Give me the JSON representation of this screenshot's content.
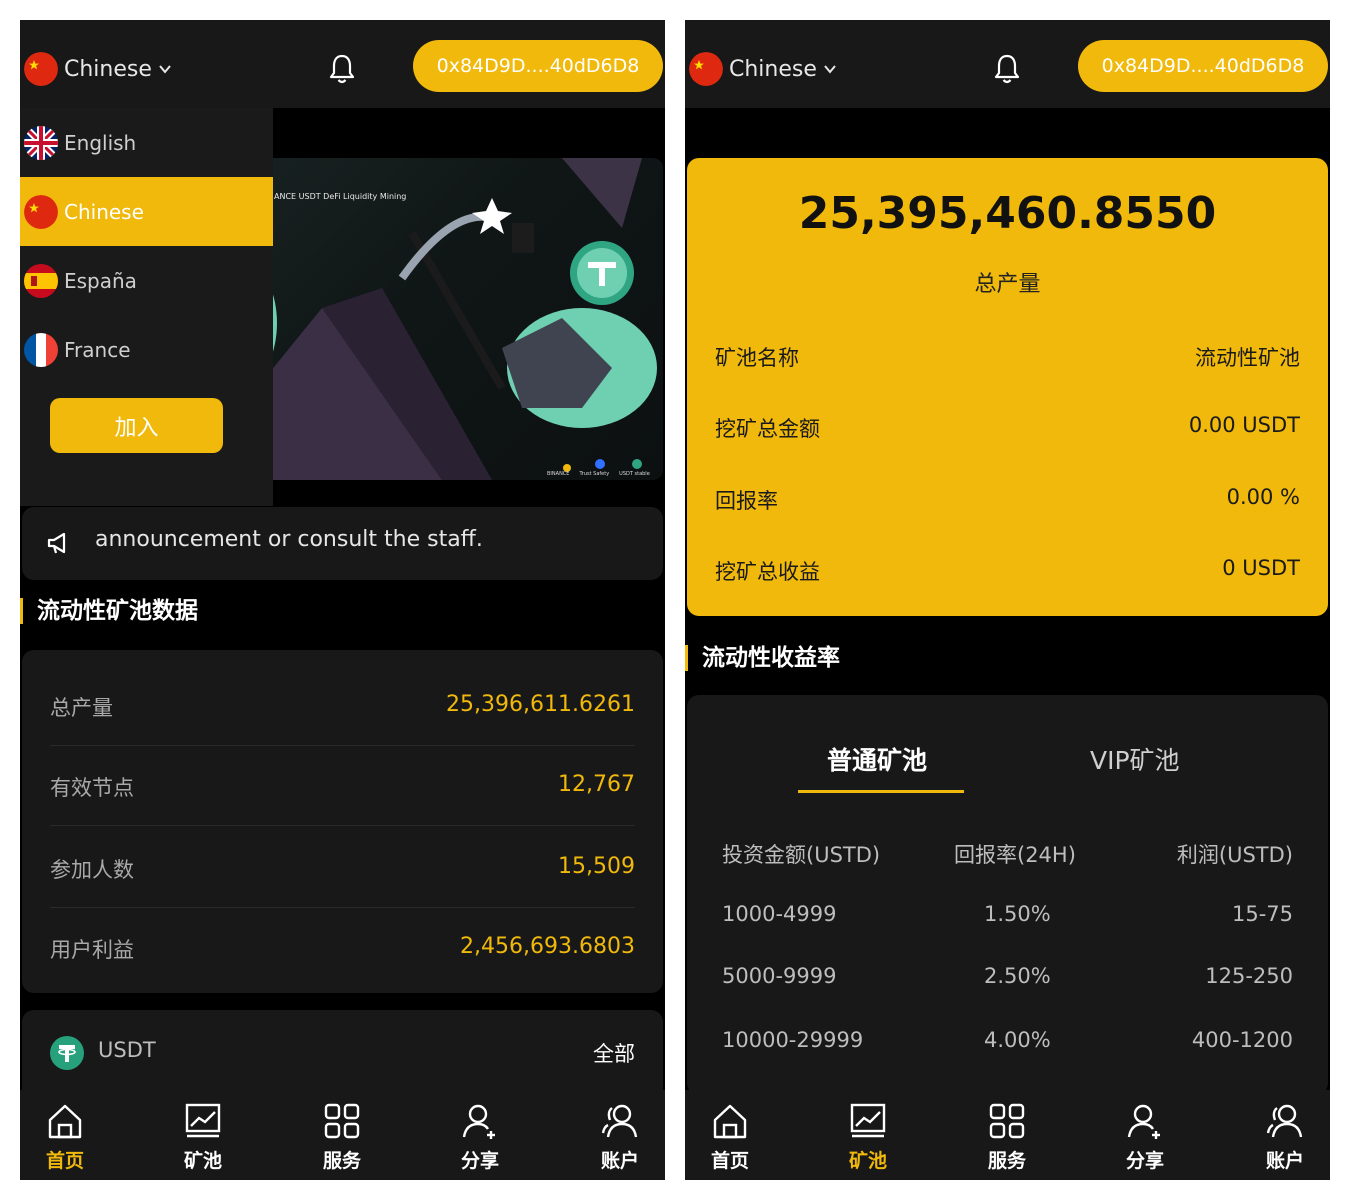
{
  "header": {
    "language": "Chinese",
    "wallet": "0x84D9D....40dD6D8"
  },
  "language_menu": {
    "items": [
      {
        "label": "English"
      },
      {
        "label": "Chinese"
      },
      {
        "label": "España"
      },
      {
        "label": "France"
      }
    ],
    "join_label": "加入"
  },
  "banner": {
    "title": "USDT DeFi Liquidity Mining",
    "brand_left": "ANCE",
    "logos": [
      "BINANCE",
      "Trust Safety",
      "USDT stable"
    ]
  },
  "announcement": {
    "text": "announcement or consult the staff."
  },
  "pool_data": {
    "title": "流动性矿池数据",
    "rows": [
      {
        "label": "总产量",
        "value": "25,396,611.6261"
      },
      {
        "label": "有效节点",
        "value": "12,767"
      },
      {
        "label": "参加人数",
        "value": "15,509"
      },
      {
        "label": "用户利益",
        "value": "2,456,693.6803"
      }
    ]
  },
  "usdt_card": {
    "label": "USDT",
    "all_label": "全部"
  },
  "mining": {
    "total_value": "25,395,460.8550",
    "total_label": "总产量",
    "rows": [
      {
        "label": "矿池名称",
        "value": "流动性矿池"
      },
      {
        "label": "挖矿总金额",
        "value": "0.00 USDT"
      },
      {
        "label": "回报率",
        "value": "0.00 %"
      },
      {
        "label": "挖矿总收益",
        "value": "0 USDT"
      }
    ]
  },
  "yield": {
    "title": "流动性收益率",
    "tabs": [
      "普通矿池",
      "VIP矿池"
    ],
    "headers": [
      "投资金额(USTD)",
      "回报率(24H)",
      "利润(USTD)"
    ],
    "rows": [
      [
        "1000-4999",
        "1.50%",
        "15-75"
      ],
      [
        "5000-9999",
        "2.50%",
        "125-250"
      ],
      [
        "10000-29999",
        "4.00%",
        "400-1200"
      ]
    ]
  },
  "nav": {
    "items": [
      {
        "label": "首页",
        "icon": "home-icon"
      },
      {
        "label": "矿池",
        "icon": "chart-icon"
      },
      {
        "label": "服务",
        "icon": "grid-icon"
      },
      {
        "label": "分享",
        "icon": "user-add-icon"
      },
      {
        "label": "账户",
        "icon": "users-icon"
      }
    ]
  },
  "colors": {
    "accent": "#f0b90b",
    "background": "#000000",
    "card": "#181818"
  }
}
